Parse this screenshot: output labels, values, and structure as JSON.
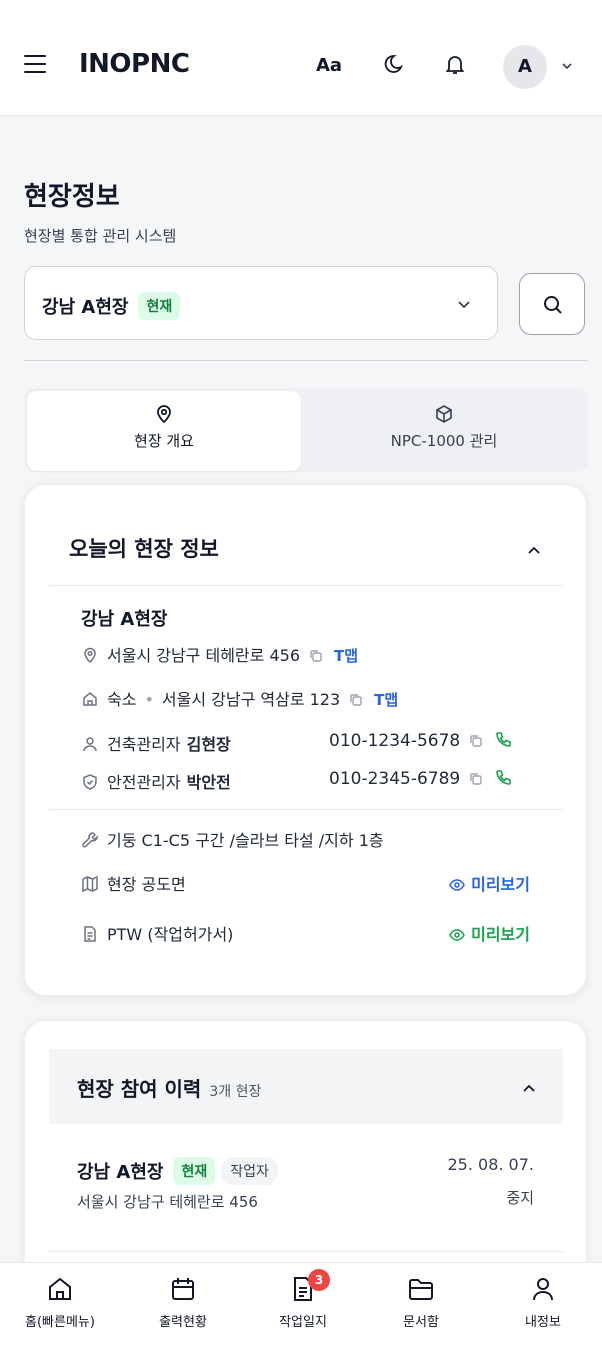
{
  "header": {
    "brand": "INOPNC",
    "font_size_label": "Aa",
    "avatar_letter": "A"
  },
  "page": {
    "title": "현장정보",
    "subtitle": "현장별 통합 관리 시스템"
  },
  "site_selector": {
    "selected_site": "강남 A현장",
    "current_badge": "현재"
  },
  "tabs": [
    {
      "label": "현장 개요",
      "icon": "location-pin-icon",
      "active": true
    },
    {
      "label": "NPC-1000 관리",
      "icon": "package-icon",
      "active": false
    }
  ],
  "today_card": {
    "title": "오늘의 현장 정보",
    "site_name": "강남 A현장",
    "address": "서울시 강남구 테헤란로 456",
    "address_map_link": "T맵",
    "lodging_label": "숙소",
    "lodging_separator": "•",
    "lodging_address": "서울시 강남구 역삼로 123",
    "lodging_map_link": "T맵",
    "managers": [
      {
        "role": "건축관리자",
        "name": "김현장",
        "phone": "010-1234-5678"
      },
      {
        "role": "안전관리자",
        "name": "박안전",
        "phone": "010-2345-6789"
      }
    ],
    "work_scope": "기둥 C1-C5 구간 /슬라브 타설 /지하 1층",
    "drawing_label": "현장 공도면",
    "drawing_preview": "미리보기",
    "ptw_label": "PTW (작업허가서)",
    "ptw_preview": "미리보기"
  },
  "history_card": {
    "title": "현장 참여 이력",
    "count": "3개 현장",
    "items": [
      {
        "name": "강남 A현장",
        "current_badge": "현재",
        "role_badge": "작업자",
        "address": "서울시 강남구 테헤란로 456",
        "date": "25. 08. 07.",
        "status": "중지"
      }
    ]
  },
  "bottom_nav": [
    {
      "label": "홈(빠른메뉴)",
      "icon": "home-icon"
    },
    {
      "label": "출력현황",
      "icon": "calendar-icon"
    },
    {
      "label": "작업일지",
      "icon": "document-icon",
      "badge": "3"
    },
    {
      "label": "문서함",
      "icon": "folder-icon"
    },
    {
      "label": "내정보",
      "icon": "user-icon"
    }
  ],
  "colors": {
    "accent_green": "#16a34a",
    "link_blue": "#2563eb",
    "badge_red": "#ef4444"
  }
}
